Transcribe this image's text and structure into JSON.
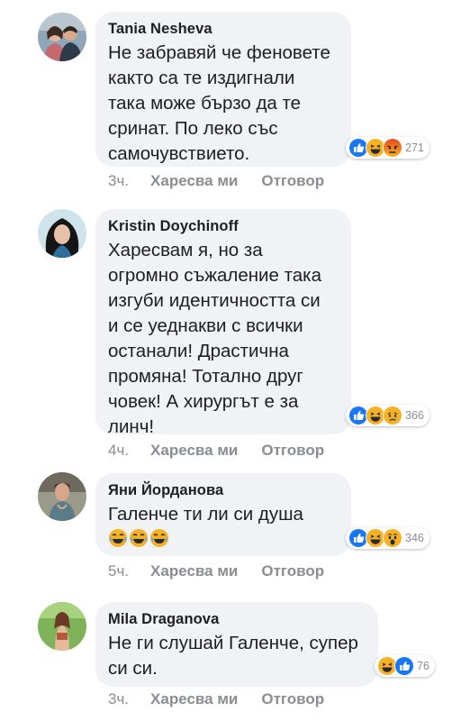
{
  "comments": [
    {
      "author": "Tania Nesheva",
      "text": "Не забравяй че феновете\nкакто са те издигнали\nтака може бързо да те\nсринат. По леко със\nсамочувствието.",
      "reactions": [
        "like-reaction-icon",
        "haha-reaction-icon",
        "angry-reaction-icon"
      ],
      "reaction_count": "271",
      "time": "3ч.",
      "like_label": "Харесва ми",
      "reply_label": "Отговор"
    },
    {
      "author": "Kristin Doychinoff",
      "text": "Харесвам я, но за\nогромно съжаление така\nизгуби идентичността си\nи се уеднакви с всички\nостанали! Драстична\nпромяна! Тотално друг\nчовек! А хирургът е за\nлинч!",
      "reactions": [
        "like-reaction-icon",
        "haha-reaction-icon",
        "sad-reaction-icon"
      ],
      "reaction_count": "366",
      "time": "4ч.",
      "like_label": "Харесва ми",
      "reply_label": "Отговор"
    },
    {
      "author": "Яни Йорданова",
      "text": "Галенче ти ли си душа",
      "inline_emojis": [
        "tears-of-joy-emoji",
        "tears-of-joy-emoji",
        "tears-of-joy-emoji"
      ],
      "reactions": [
        "like-reaction-icon",
        "haha-reaction-icon",
        "wow-reaction-icon"
      ],
      "reaction_count": "346",
      "time": "5ч.",
      "like_label": "Харесва ми",
      "reply_label": "Отговор"
    },
    {
      "author": "Mila Draganova",
      "text": "Не ги слушай Галенче, супер\nси си.",
      "reactions": [
        "haha-reaction-icon",
        "like-reaction-icon"
      ],
      "reaction_count": "76",
      "time": "3ч.",
      "like_label": "Харесва ми",
      "reply_label": "Отговор"
    }
  ],
  "colors": {
    "bubble": "#f0f2f5",
    "like_blue": "#1877f2",
    "haha_yellow": "#f7b125",
    "angry_orange": "#e9710f",
    "meta_gray": "#8a8d91"
  }
}
